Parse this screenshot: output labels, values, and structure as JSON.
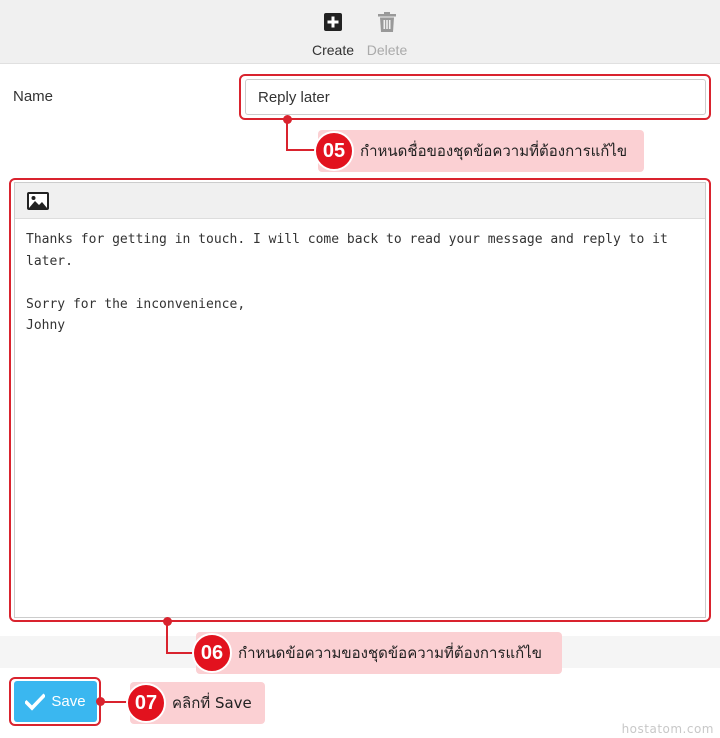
{
  "toolbar": {
    "create_label": "Create",
    "delete_label": "Delete",
    "create_icon": "plus-square-icon",
    "delete_icon": "trash-icon"
  },
  "form": {
    "name_label": "Name",
    "name_value": "Reply later"
  },
  "editor": {
    "toolbar_icon": "image-icon",
    "content": "Thanks for getting in touch. I will come back to read your message and reply to it\nlater.\n\nSorry for the inconvenience,\nJohny"
  },
  "actions": {
    "save_label": "Save",
    "save_icon": "check-icon"
  },
  "annotations": {
    "step5": {
      "number": "05",
      "text": "กำหนดชื่อของชุดข้อความที่ต้องการแก้ไข"
    },
    "step6": {
      "number": "06",
      "text": "กำหนดข้อความของชุดข้อความที่ต้องการแก้ไข"
    },
    "step7": {
      "number": "07",
      "text": "คลิกที่ Save"
    }
  },
  "watermark": "hostatom.com",
  "colors": {
    "highlight": "#d9232e",
    "callout_bg": "#fbd0d3",
    "save_button": "#3ab7f0",
    "toolbar_bg": "#f0f0f0"
  }
}
